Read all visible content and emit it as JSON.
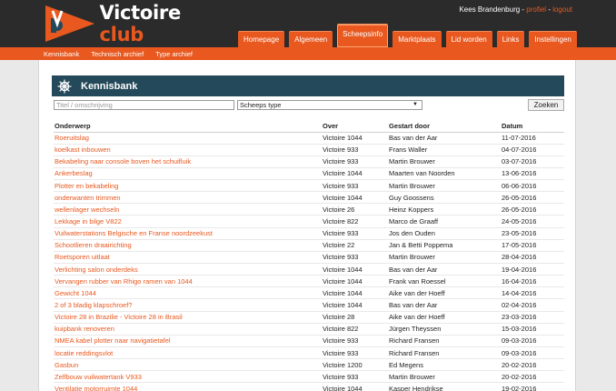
{
  "brand": {
    "name_main": "Victoire",
    "name_club": "club",
    "colors": {
      "accent": "#e8581f",
      "header": "#2b2b2b",
      "titlebar": "#24495a"
    }
  },
  "user": {
    "name": "Kees Brandenburg",
    "sep1": " - ",
    "profile": "profiel",
    "sep2": " - ",
    "logout": "logout"
  },
  "nav": {
    "tabs": [
      {
        "label": "Homepage"
      },
      {
        "label": "Algemeen"
      },
      {
        "label": "Scheepsinfo"
      },
      {
        "label": "Marktplaats"
      },
      {
        "label": "Lid worden"
      },
      {
        "label": "Links"
      },
      {
        "label": "Instellingen"
      }
    ],
    "active": "Scheepsinfo"
  },
  "subnav": {
    "items": [
      {
        "label": "Kennisbank"
      },
      {
        "label": "Technisch archief"
      },
      {
        "label": "Type archief"
      }
    ]
  },
  "page": {
    "title": "Kennisbank",
    "icon": "ship-wheel-icon"
  },
  "filters": {
    "search_placeholder": "Titel / omschrijving",
    "type_select": "Scheeps type",
    "search_button": "Zoeken"
  },
  "table": {
    "headers": {
      "subject": "Onderwerp",
      "about": "Over",
      "started_by": "Gestart door",
      "date": "Datum"
    },
    "rows": [
      {
        "subject": "Roeruitslag",
        "about": "Victoire 1044",
        "started_by": "Bas van der Aar",
        "date": "11-07-2016"
      },
      {
        "subject": "koelkast inbouwen",
        "about": "Victoire 933",
        "started_by": "Frans Waller",
        "date": "04-07-2016"
      },
      {
        "subject": "Bekabeling naar console boven het schuifluik",
        "about": "Victoire 933",
        "started_by": "Martin Brouwer",
        "date": "03-07-2016"
      },
      {
        "subject": "Ankerbeslag",
        "about": "Victoire 1044",
        "started_by": "Maarten van Noorden",
        "date": "13-06-2016"
      },
      {
        "subject": "Plotter en bekabeling",
        "about": "Victoire 933",
        "started_by": "Martin Brouwer",
        "date": "06-06-2016"
      },
      {
        "subject": "onderwanten trimmen",
        "about": "Victoire 1044",
        "started_by": "Guy Goossens",
        "date": "26-05-2016"
      },
      {
        "subject": "wellenlager wechseln",
        "about": "Victoire 26",
        "started_by": "Heinz Koppers",
        "date": "26-05-2016"
      },
      {
        "subject": "Lekkage in bilge V822",
        "about": "Victoire 822",
        "started_by": "Marco de Graaff",
        "date": "24-05-2016"
      },
      {
        "subject": "Vuilwaterstations Belgische en Franse noordzeekust",
        "about": "Victoire 933",
        "started_by": "Jos den Ouden",
        "date": "23-05-2016"
      },
      {
        "subject": "Schootlieren draairichting",
        "about": "Victoire 22",
        "started_by": "Jan & Betti Poppema",
        "date": "17-05-2016"
      },
      {
        "subject": "Roetsporen uitlaat",
        "about": "Victoire 933",
        "started_by": "Martin Brouwer",
        "date": "28-04-2016"
      },
      {
        "subject": "Verlichting salon onderdeks",
        "about": "Victoire 1044",
        "started_by": "Bas van der Aar",
        "date": "19-04-2016"
      },
      {
        "subject": "Vervangen rubber van Rhigo ramen van 1044",
        "about": "Victoire 1044",
        "started_by": "Frank van Roessel",
        "date": "16-04-2016"
      },
      {
        "subject": "Gewicht 1044",
        "about": "Victoire 1044",
        "started_by": "Aike van der Hoeff",
        "date": "14-04-2016"
      },
      {
        "subject": "2 of 3 bladig klapschroef?",
        "about": "Victoire 1044",
        "started_by": "Bas van der Aar",
        "date": "02-04-2016"
      },
      {
        "subject": "Victoire 28 in Brazilie - Victoire 28 in Brasil",
        "about": "Victoire 28",
        "started_by": "Aike van der Hoeff",
        "date": "23-03-2016"
      },
      {
        "subject": "kuipbank renoveren",
        "about": "Victoire 822",
        "started_by": "Jürgen Theyssen",
        "date": "15-03-2016"
      },
      {
        "subject": "NMEA kabel plotter naar navigatietafel",
        "about": "Victoire 933",
        "started_by": "Richard Fransen",
        "date": "09-03-2016"
      },
      {
        "subject": "locatie reddingsvlot",
        "about": "Victoire 933",
        "started_by": "Richard Fransen",
        "date": "09-03-2016"
      },
      {
        "subject": "Gasbun",
        "about": "Victoire 1200",
        "started_by": "Ed Megens",
        "date": "20-02-2016"
      },
      {
        "subject": "Zelfbouw vuilwatertank V933",
        "about": "Victoire 933",
        "started_by": "Martin Brouwer",
        "date": "20-02-2016"
      },
      {
        "subject": "Ventilatie motorruimte 1044",
        "about": "Victoire 1044",
        "started_by": "Kasper Hendrikse",
        "date": "19-02-2016"
      }
    ]
  }
}
